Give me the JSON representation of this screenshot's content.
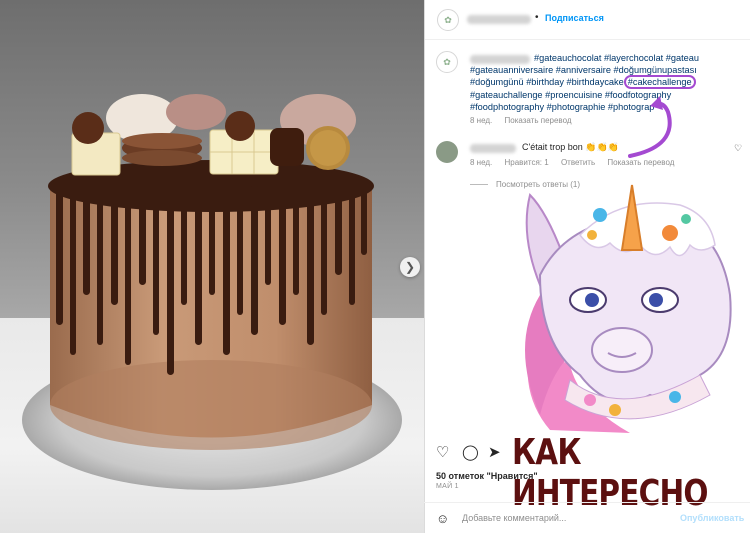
{
  "post": {
    "follow_label": "Подписаться",
    "caption_tags": [
      "#gateauchocolat #layerchocolat #gateau",
      "#gateauanniversaire #anniversaire #doğumgünupastası",
      "#doğumgünü #birthday #birthdaycake"
    ],
    "highlight_tag": "#cakechallenge",
    "caption_tags_after": [
      "#gateauchallenge #proencuisine #foodfotography",
      "#foodphotography #photographie #photograp"
    ],
    "caption_time": "8 нед.",
    "show_translation": "Показать перевод",
    "comment": {
      "text": "C'était trop bon 👏👏👏",
      "time": "8 нед.",
      "likes": "Нравится: 1",
      "reply": "Ответить",
      "translate": "Показать перевод"
    },
    "view_replies": "Посмотреть ответы (1)",
    "overlay_text": "КАК ИНТЕРЕСНО",
    "likes_count": "50 отметок \"Нравится\"",
    "date": "МАЙ 1",
    "comment_placeholder": "Добавьте комментарий...",
    "publish_label": "Опубликовать"
  },
  "icons": {
    "carousel_next": "chevron-right-icon",
    "heart": "heart-icon",
    "comment": "comment-icon",
    "share": "share-icon",
    "emoji": "emoji-icon"
  },
  "colors": {
    "link_blue": "#0095f6",
    "hashtag": "#00376b",
    "highlight_purple": "#a44ad1",
    "overlay_text": "#5c1010",
    "muted": "#8e8e8e"
  }
}
